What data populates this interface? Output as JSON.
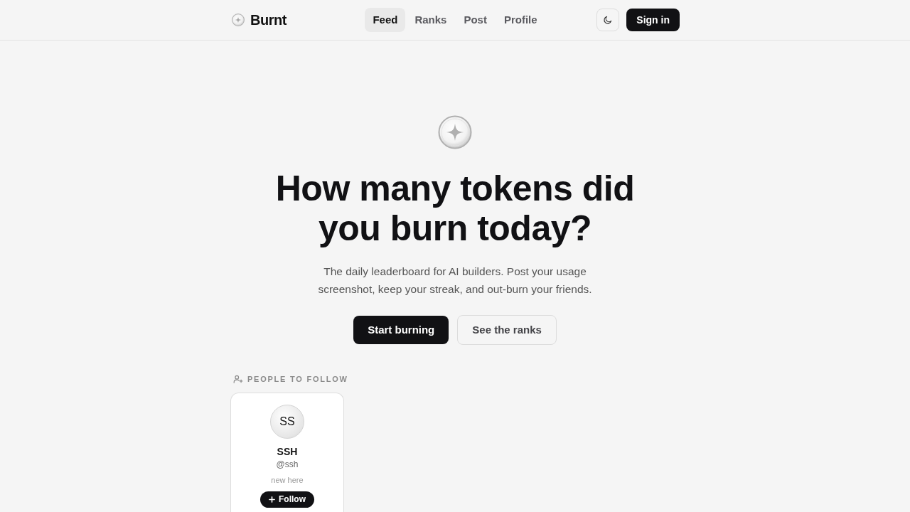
{
  "header": {
    "logo": "Burnt",
    "nav": [
      {
        "label": "Feed",
        "selected": true
      },
      {
        "label": "Ranks",
        "selected": false
      },
      {
        "label": "Post",
        "selected": false
      },
      {
        "label": "Profile",
        "selected": false
      }
    ],
    "sign_in": "Sign in"
  },
  "hero": {
    "title": "How many tokens did you burn today?",
    "subtitle": "The daily leaderboard for AI builders. Post your usage screenshot, keep your streak, and out-burn your friends.",
    "buttons": [
      {
        "label": "Start burning",
        "kind": "primary"
      },
      {
        "label": "See the ranks",
        "kind": "secondary"
      }
    ]
  },
  "people_to_follow": {
    "heading": "PEOPLE TO FOLLOW",
    "people": [
      {
        "initials": "SS",
        "name": "SSH",
        "handle": "@ssh",
        "note": "new here",
        "button": "Follow"
      }
    ]
  }
}
